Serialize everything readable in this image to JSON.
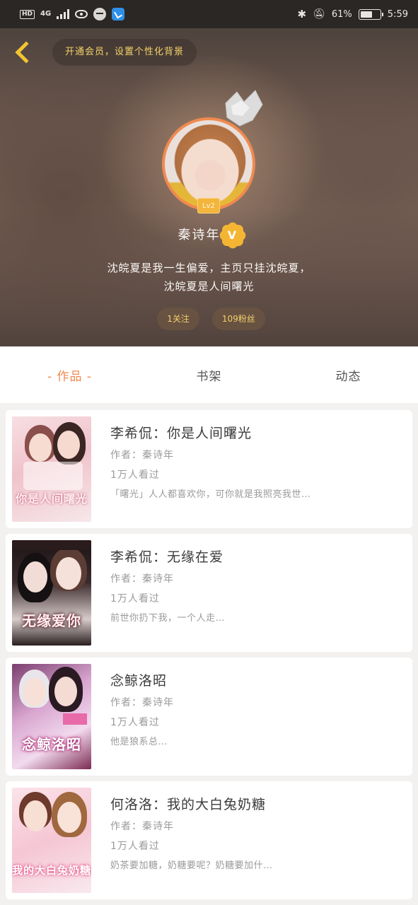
{
  "status_bar": {
    "hd": "HD",
    "network": "4G",
    "battery_text": "61%",
    "battery_level": 0.61,
    "time": "5:59"
  },
  "header": {
    "back_icon": "chevron-left-icon",
    "vip_banner": "开通会员，设置个性化背景"
  },
  "profile": {
    "level": "Lv2",
    "name": "秦诗年",
    "verified_badge": "V",
    "bio_line1": "沈皖夏是我一生偏爱，主页只挂沈皖夏，",
    "bio_line2": "沈皖夏是人间曙光",
    "following": "1关注",
    "fans": "109粉丝",
    "accent_color": "#f08a50",
    "badge_color": "#f4b533"
  },
  "tabs": [
    {
      "label": "- 作品 -",
      "active": true
    },
    {
      "label": "书架",
      "active": false
    },
    {
      "label": "动态",
      "active": false
    }
  ],
  "books": [
    {
      "title": "李希侃：你是人间曙光",
      "author": "作者：秦诗年",
      "views": "1万人看过",
      "desc": "「曙光」人人都喜欢你，可你就是我照亮我世…",
      "cover_text": "你是人间曙光"
    },
    {
      "title": "李希侃：无缘在爱",
      "author": "作者：秦诗年",
      "views": "1万人看过",
      "desc": "前世你扔下我，一个人走…",
      "cover_text": "无缘爱你"
    },
    {
      "title": "念鲸洛昭",
      "author": "作者：秦诗年",
      "views": "1万人看过",
      "desc": "他是狼系总…",
      "cover_text": "念鲸洛昭"
    },
    {
      "title": "何洛洛：我的大白兔奶糖",
      "author": "作者：秦诗年",
      "views": "1万人看过",
      "desc": "奶茶要加糖，奶糖要呢？奶糖要加什…",
      "cover_text": "我的大白兔奶糖"
    }
  ]
}
